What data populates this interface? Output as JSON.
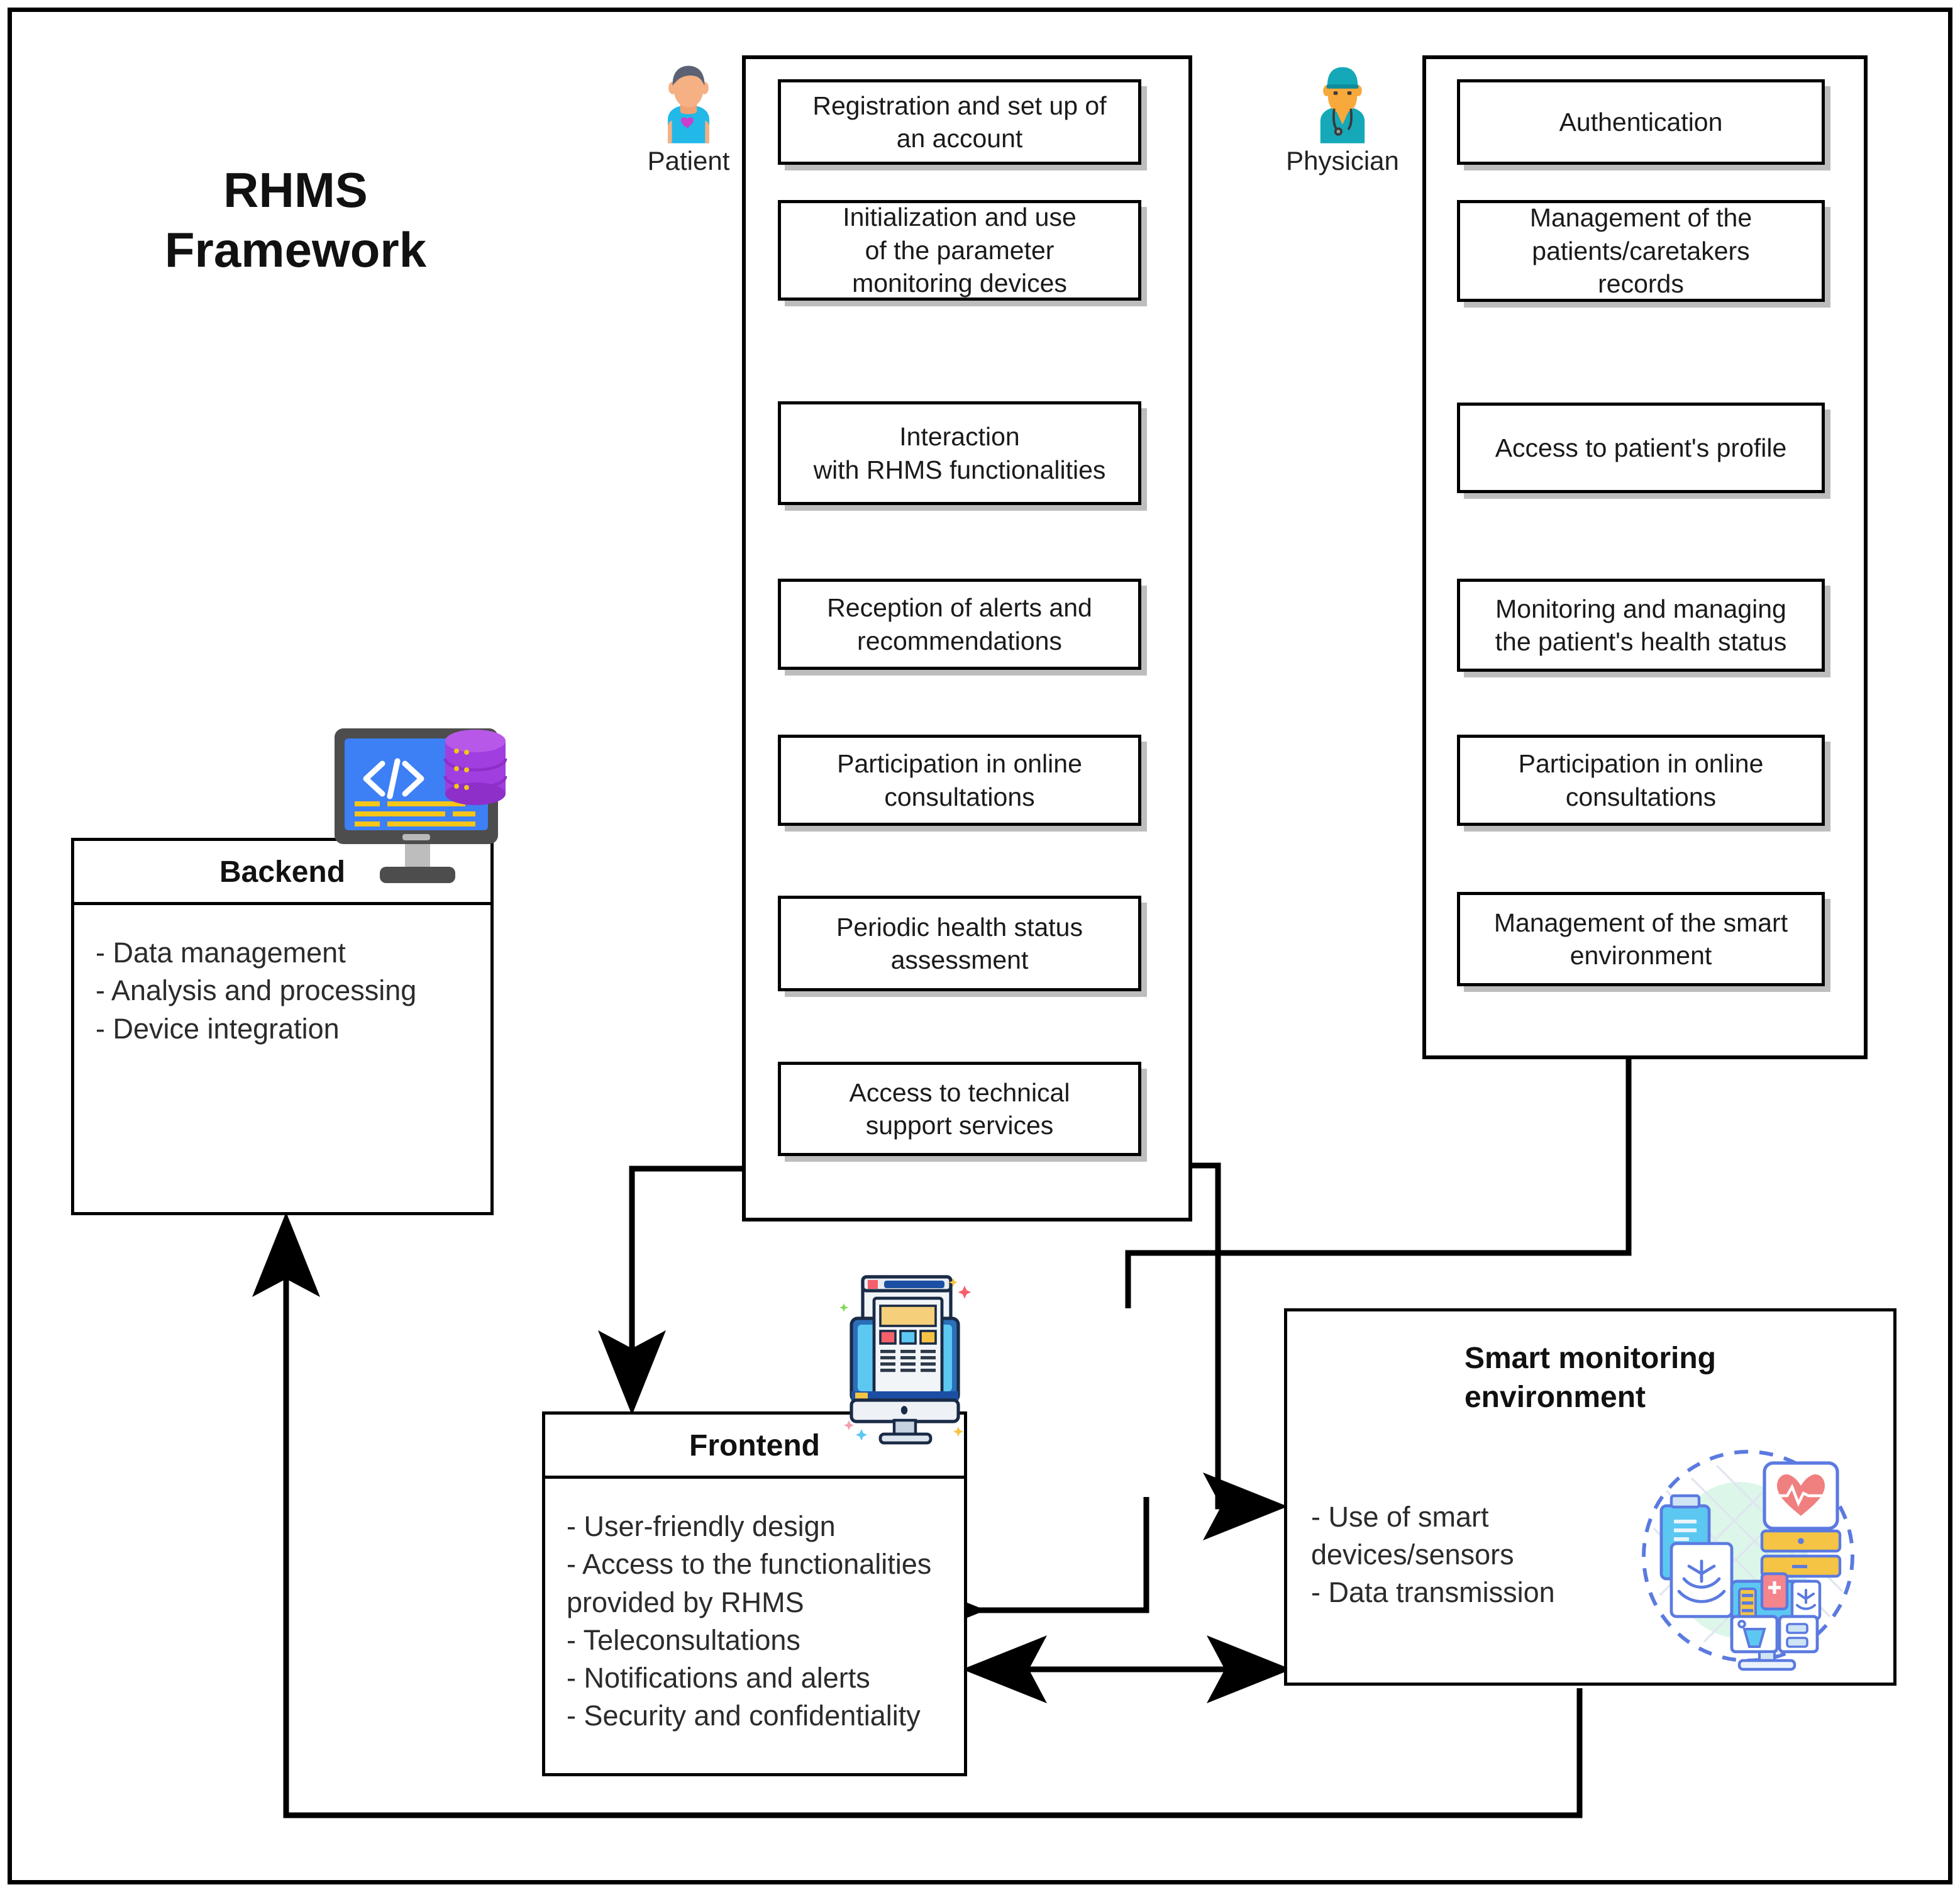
{
  "diagram": {
    "title_line1": "RHMS",
    "title_line2": "Framework"
  },
  "actors": {
    "patient": {
      "label": "Patient",
      "icon": "patient-avatar-icon"
    },
    "physician": {
      "label": "Physician",
      "icon": "physician-avatar-icon"
    }
  },
  "patient_features": [
    "Registration and set up of\nan account",
    "Initialization and use\nof the parameter\nmonitoring devices",
    "Interaction\nwith RHMS functionalities",
    "Reception of alerts and\nrecommendations",
    "Participation in online\nconsultations",
    "Periodic health status\nassessment",
    "Access to technical\nsupport services"
  ],
  "physician_features": [
    "Authentication",
    "Management of the\npatients/caretakers\nrecords",
    "Access to patient's profile",
    "Monitoring and managing\nthe patient's health status",
    "Participation in online\nconsultations",
    "Management of the smart\nenvironment"
  ],
  "components": {
    "backend": {
      "title": "Backend",
      "icon": "server-database-monitor-icon",
      "items": [
        "- Data management",
        "- Analysis and processing",
        "- Device integration"
      ]
    },
    "frontend": {
      "title": "Frontend",
      "icon": "desktop-ui-icon",
      "items": [
        "- User-friendly design",
        "- Access to the functionalities",
        "provided by RHMS",
        "- Teleconsultations",
        "- Notifications and alerts",
        "- Security and confidentiality"
      ]
    },
    "smart_environment": {
      "title": "Smart monitoring\nenvironment",
      "icon": "smart-medical-devices-icon",
      "items": [
        "- Use of smart",
        "devices/sensors",
        "- Data transmission"
      ]
    }
  },
  "colors": {
    "stroke": "#000000",
    "box_fill": "#ffffff",
    "shadow": "#bfbfbf",
    "patient_shirt": "#22b8e8",
    "patient_hair": "#5c6274",
    "patient_skin": "#f5b083",
    "patient_heart": "#cc3ecc",
    "physician_scrubs": "#15a8b8",
    "physician_skin": "#f7a93b",
    "backend_screen": "#3d7ff5",
    "backend_db": "#a13ee0",
    "backend_code": "#f5c518",
    "frontend_screen": "#5cc8f2",
    "smart_accent": "#5b7ae0",
    "smart_heart": "#f08080",
    "smart_yellow": "#f5c444"
  }
}
